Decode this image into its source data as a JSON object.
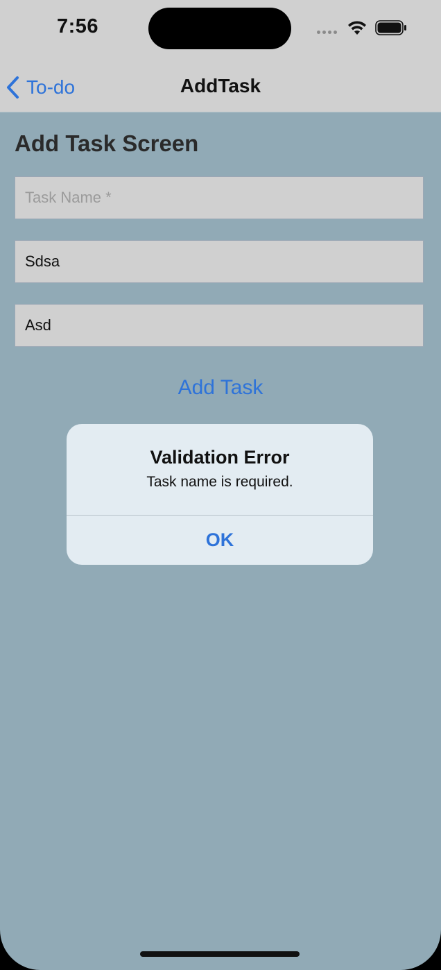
{
  "status_bar": {
    "time": "7:56"
  },
  "nav": {
    "back_label": "To-do",
    "title": "AddTask"
  },
  "screen": {
    "heading": "Add Task Screen",
    "fields": [
      {
        "placeholder": "Task Name *",
        "value": ""
      },
      {
        "placeholder": "",
        "value": "Sdsa"
      },
      {
        "placeholder": "",
        "value": "Asd"
      }
    ],
    "add_button_label": "Add Task"
  },
  "alert": {
    "title": "Validation Error",
    "message": "Task name is required.",
    "ok_label": "OK"
  },
  "icons": {
    "back": "chevron-left-icon",
    "wifi": "wifi-icon",
    "battery": "battery-icon",
    "signal": "cellular-signal-icon"
  },
  "colors": {
    "accent": "#2e73d9",
    "background": "#91aab6",
    "nav_bar": "#d0d0d0",
    "alert_background": "#e3ecf2"
  }
}
